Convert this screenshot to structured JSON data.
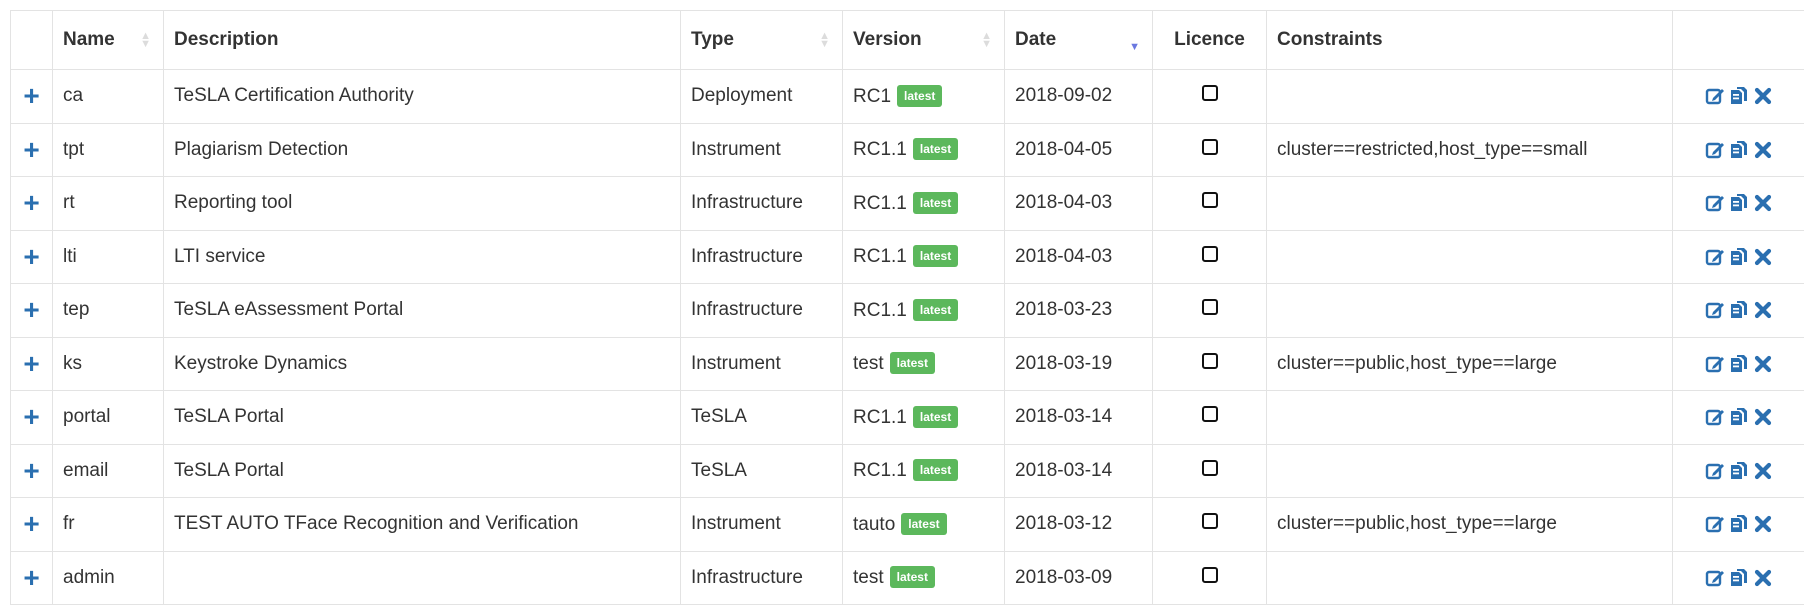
{
  "table": {
    "headers": {
      "name": "Name",
      "description": "Description",
      "type": "Type",
      "version": "Version",
      "date": "Date",
      "licence": "Licence",
      "constraints": "Constraints"
    },
    "sort": {
      "column": "date",
      "direction": "descending"
    },
    "expand_symbol": "+",
    "badge_label": "latest",
    "colors": {
      "badge": "#5cb85c",
      "icons": "#2a6fb0",
      "sort_active": "#6a78e0"
    },
    "action_icons": [
      "edit-icon",
      "copy-icon",
      "delete-icon"
    ],
    "rows": [
      {
        "name": "ca",
        "description": "TeSLA Certification Authority",
        "type": "Deployment",
        "version": "RC1",
        "date": "2018-09-02",
        "licence": false,
        "constraints": ""
      },
      {
        "name": "tpt",
        "description": "Plagiarism Detection",
        "type": "Instrument",
        "version": "RC1.1",
        "date": "2018-04-05",
        "licence": false,
        "constraints": "cluster==restricted,host_type==small"
      },
      {
        "name": "rt",
        "description": "Reporting tool",
        "type": "Infrastructure",
        "version": "RC1.1",
        "date": "2018-04-03",
        "licence": false,
        "constraints": ""
      },
      {
        "name": "lti",
        "description": "LTI service",
        "type": "Infrastructure",
        "version": "RC1.1",
        "date": "2018-04-03",
        "licence": false,
        "constraints": ""
      },
      {
        "name": "tep",
        "description": "TeSLA eAssessment Portal",
        "type": "Infrastructure",
        "version": "RC1.1",
        "date": "2018-03-23",
        "licence": false,
        "constraints": ""
      },
      {
        "name": "ks",
        "description": "Keystroke Dynamics",
        "type": "Instrument",
        "version": "test",
        "date": "2018-03-19",
        "licence": false,
        "constraints": "cluster==public,host_type==large"
      },
      {
        "name": "portal",
        "description": "TeSLA Portal",
        "type": "TeSLA",
        "version": "RC1.1",
        "date": "2018-03-14",
        "licence": false,
        "constraints": ""
      },
      {
        "name": "email",
        "description": "TeSLA Portal",
        "type": "TeSLA",
        "version": "RC1.1",
        "date": "2018-03-14",
        "licence": false,
        "constraints": ""
      },
      {
        "name": "fr",
        "description": "TEST AUTO TFace Recognition and Verification",
        "type": "Instrument",
        "version": "tauto",
        "date": "2018-03-12",
        "licence": false,
        "constraints": "cluster==public,host_type==large"
      },
      {
        "name": "admin",
        "description": "",
        "type": "Infrastructure",
        "version": "test",
        "date": "2018-03-09",
        "licence": false,
        "constraints": ""
      }
    ]
  }
}
